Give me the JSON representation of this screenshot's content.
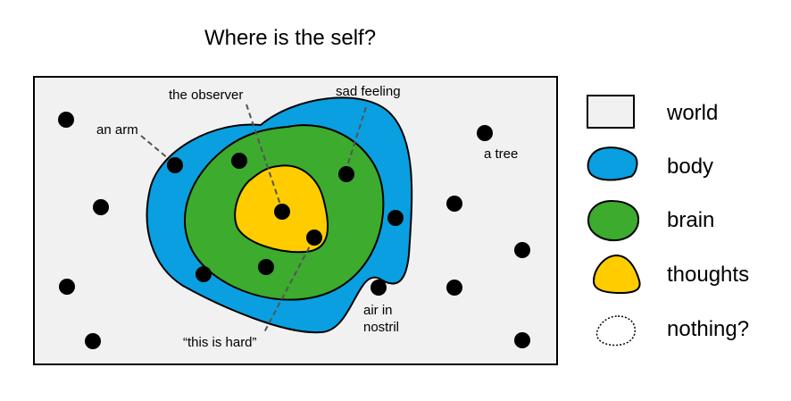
{
  "title": "Where is the self?",
  "colors": {
    "world": "#f1f1f1",
    "body": "#0a9fe0",
    "brain": "#3cab2e",
    "thoughts": "#ffcc00",
    "outline": "#000000",
    "dot": "#000000",
    "leader": "#555555"
  },
  "annotations": {
    "an_arm": "an arm",
    "the_observer": "the observer",
    "sad_feeling": "sad feeling",
    "a_tree": "a tree",
    "air_in_nostril_1": "air in",
    "air_in_nostril_2": "nostril",
    "this_is_hard": "“this is hard”"
  },
  "legend": [
    {
      "label": "world",
      "swatch": "world-box"
    },
    {
      "label": "body",
      "swatch": "body-blob"
    },
    {
      "label": "brain",
      "swatch": "brain-blob"
    },
    {
      "label": "thoughts",
      "swatch": "thoughts-blob"
    },
    {
      "label": "nothing?",
      "swatch": "dotted-outline"
    }
  ]
}
